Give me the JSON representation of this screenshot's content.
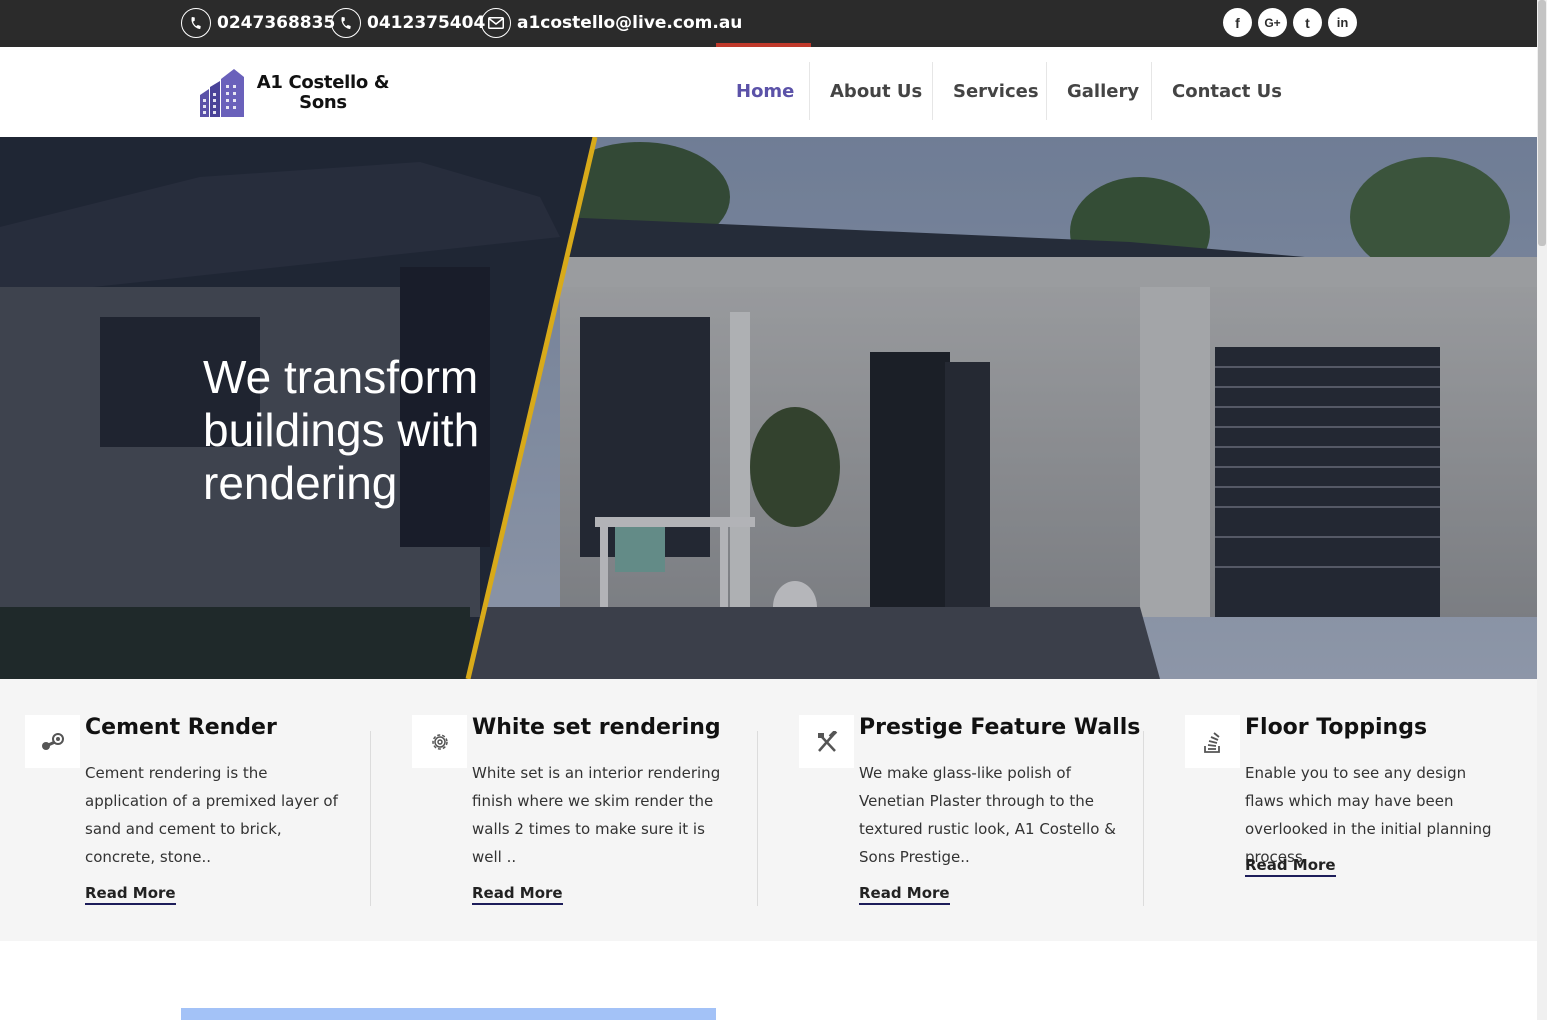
{
  "topbar": {
    "phone1": "0247368835",
    "phone2": "0412375404",
    "email": "a1costello@live.com.au",
    "social": [
      "facebook-icon",
      "google-plus-icon",
      "twitter-icon",
      "linkedin-icon"
    ],
    "social_labels": {
      "facebook": "f",
      "google": "G+",
      "twitter": "t",
      "linkedin": "in"
    }
  },
  "header": {
    "logo_line1": "A1 Costello &",
    "logo_line2": "Sons",
    "nav": [
      "Home",
      "About Us",
      "Services",
      "Gallery",
      "Contact Us"
    ],
    "active_nav": "Home"
  },
  "hero": {
    "title": "We transform buildings with rendering"
  },
  "services": [
    {
      "icon": "steam-icon",
      "title": "Cement Render",
      "desc": "Cement rendering is the application of a premixed layer of sand and cement to brick, concrete, stone..",
      "more": "Read More"
    },
    {
      "icon": "gear-icon",
      "title": "White set rendering",
      "desc": "White set is an interior rendering finish where we skim render the walls 2 times to make sure it is well ..",
      "more": "Read More"
    },
    {
      "icon": "tools-icon",
      "title": "Prestige Feature Walls",
      "desc": "We make glass-like polish of Venetian Plaster through to the textured rustic look, A1 Costello & Sons Prestige..",
      "more": "Read More"
    },
    {
      "icon": "stack-icon",
      "title": "Floor Toppings",
      "desc": "Enable you to see any design flaws which may have been overlooked in the initial planning process.",
      "more": "Read More"
    }
  ],
  "colors": {
    "topbar": "#2b2b2b",
    "accent": "#5b52a8",
    "active_bar": "#c0392b",
    "services_bg": "#f5f5f5"
  }
}
